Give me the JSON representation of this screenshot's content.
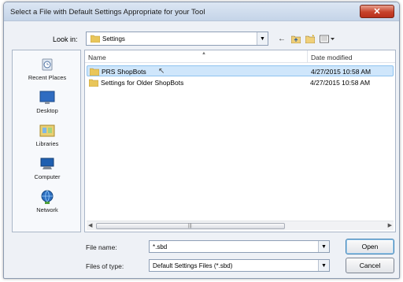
{
  "dialog": {
    "title": "Select a File with Default Settings Appropriate for your Tool",
    "close_label": "✕"
  },
  "lookin": {
    "label": "Look in:",
    "value": "Settings"
  },
  "places": [
    {
      "label": "Recent Places",
      "icon": "recent-places-icon"
    },
    {
      "label": "Desktop",
      "icon": "desktop-icon"
    },
    {
      "label": "Libraries",
      "icon": "libraries-icon"
    },
    {
      "label": "Computer",
      "icon": "computer-icon"
    },
    {
      "label": "Network",
      "icon": "network-icon"
    }
  ],
  "filelist": {
    "columns": {
      "name": "Name",
      "date": "Date modified"
    },
    "rows": [
      {
        "name": "PRS ShopBots",
        "date": "4/27/2015 10:58 AM",
        "selected": true
      },
      {
        "name": "Settings for Older ShopBots",
        "date": "4/27/2015 10:58 AM",
        "selected": false
      }
    ]
  },
  "filename": {
    "label": "File name:",
    "value": "*.sbd"
  },
  "filetype": {
    "label": "Files of type:",
    "value": "Default Settings Files (*.sbd)"
  },
  "buttons": {
    "open": "Open",
    "cancel": "Cancel"
  },
  "colors": {
    "selection": "#cfe6fb",
    "close_button": "#c7422b"
  }
}
